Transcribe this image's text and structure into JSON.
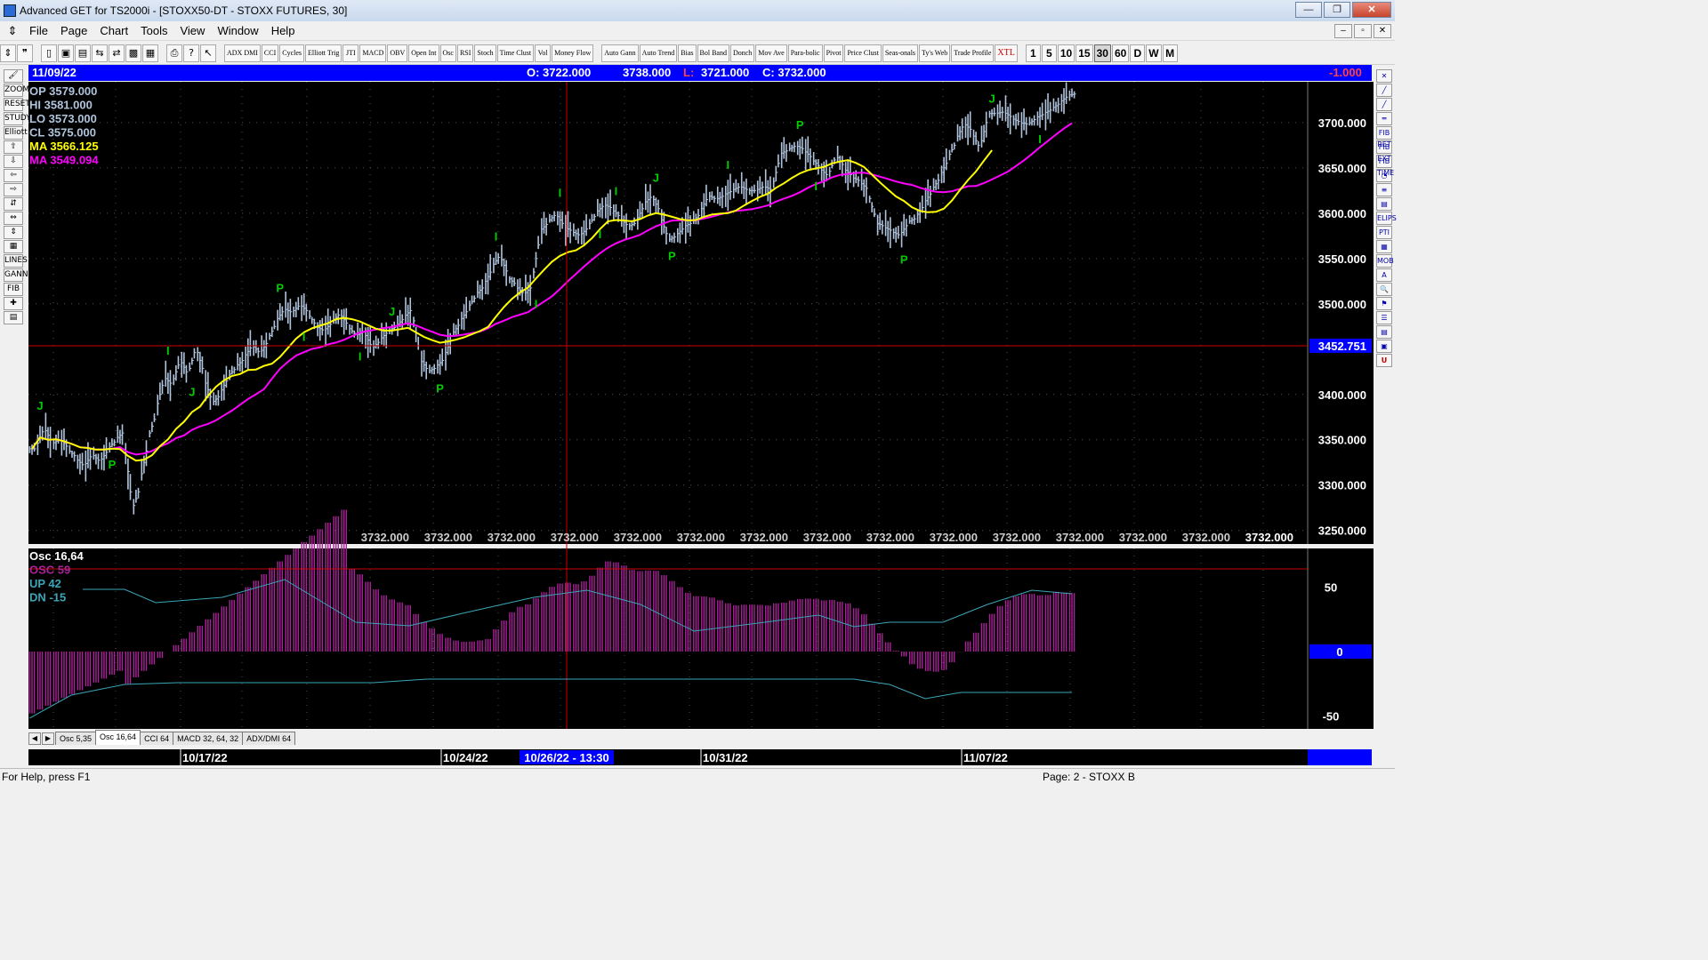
{
  "window": {
    "title": "Advanced GET for TS2000i - [STOXX50-DT - STOXX FUTURES, 30]",
    "buttons": {
      "minimize": "—",
      "maximize": "❐",
      "close": "✕"
    }
  },
  "menu": [
    "File",
    "Page",
    "Chart",
    "Tools",
    "View",
    "Window",
    "Help"
  ],
  "toolbar": {
    "studies": [
      "ADX DMI",
      "CCI",
      "Cycles",
      "Elliott Trig",
      "JTI",
      "MACD",
      "OBV",
      "Open Int",
      "Osc",
      "RSI",
      "Stoch",
      "Time Clust",
      "Vol",
      "Money Flow"
    ],
    "tools": [
      "Auto Gann",
      "Auto Trend",
      "Bias",
      "Bol Band",
      "Donch",
      "Mov Ave",
      "Para-bolic",
      "Pivot",
      "Price Clust",
      "Seas-onals",
      "Ty's Web",
      "Trade Profile",
      "XTL"
    ],
    "timeframes": [
      "1",
      "5",
      "10",
      "15",
      "30",
      "60",
      "D",
      "W",
      "M"
    ],
    "active_timeframe": "30"
  },
  "left_tools": [
    "🖌",
    "ZOOM",
    "RESET",
    "STUDY",
    "Elliott",
    "⇧",
    "⇩",
    "⇦",
    "⇨",
    "⇵",
    "⇔",
    "⇕",
    "▦",
    "LINES",
    "GANN",
    "FIB",
    "✚",
    "▤"
  ],
  "right_tools": [
    "✕",
    "╱",
    "╱",
    "═",
    "FIB RET",
    "FIB EXT",
    "FIB TIME",
    "◔",
    "≡",
    "▤",
    "ELIPS",
    "PTI",
    "▦",
    "MOB",
    "A",
    "🔍",
    "⚑",
    "☰",
    "▤",
    "▣",
    "U"
  ],
  "infobar": {
    "date": "11/09/22",
    "open": "O: 3722.000",
    "high": "3738.000",
    "low_label": "L:",
    "low": "3721.000",
    "close": "C: 3732.000",
    "change": "-1.000"
  },
  "legend": {
    "op": "OP  3579.000",
    "hi": "HI   3581.000",
    "lo": "LO  3573.000",
    "cl": "CL  3575.000",
    "ma1": "MA  3566.125",
    "ma2": "MA  3549.094"
  },
  "osc_legend": {
    "title": "Osc 16,64",
    "osc": "OSC 59",
    "up": "UP   42",
    "dn": "DN   -15"
  },
  "cursor_price": "3452.751",
  "bottom_values": [
    "3732.000",
    "3732.000",
    "3732.000",
    "3732.000",
    "3732.000",
    "3732.000",
    "3732.000",
    "3732.000",
    "3732.000",
    "3732.000",
    "3732.000",
    "3732.000",
    "3732.000",
    "3732.000",
    "3732.000"
  ],
  "date_labels": [
    "10/17/22",
    "10/24/22",
    "10/31/22",
    "11/07/22"
  ],
  "cursor_date": "10/26/22 - 13:30",
  "tabs": [
    "Osc 5,35",
    "Osc 16,64",
    "CCI 64",
    "MACD 32, 64, 32",
    "ADX/DMI 64"
  ],
  "active_tab": "Osc 16,64",
  "status": {
    "help": "For Help, press F1",
    "page": "Page: 2 - STOXX B"
  },
  "colors": {
    "chart_bg": "#000000",
    "bars": "#b0c4de",
    "ma_fast": "#ffff00",
    "ma_slow": "#ff00ff",
    "label": "#00cc00",
    "axis_text": "#ffffff",
    "infobar": "#0000ff",
    "cursor": "#cc0000",
    "osc": "#aa2299",
    "band": "#3aa6b8"
  },
  "chart_data": {
    "type": "ohlc-bar",
    "y_ticks": [
      3700,
      3650,
      3600,
      3550,
      3500,
      3400,
      3350,
      3300,
      3250
    ],
    "y_range": [
      3235,
      3745
    ],
    "osc_ticks": [
      50,
      0,
      -50
    ],
    "osc_range": [
      -60,
      80
    ],
    "closes": [
      3340,
      3365,
      3345,
      3352,
      3340,
      3330,
      3320,
      3335,
      3325,
      3340,
      3350,
      3360,
      3270,
      3300,
      3350,
      3380,
      3420,
      3410,
      3440,
      3420,
      3455,
      3420,
      3390,
      3400,
      3420,
      3430,
      3440,
      3455,
      3445,
      3460,
      3480,
      3495,
      3490,
      3500,
      3490,
      3475,
      3470,
      3480,
      3490,
      3475,
      3465,
      3470,
      3450,
      3460,
      3470,
      3475,
      3485,
      3495,
      3440,
      3425,
      3430,
      3440,
      3465,
      3480,
      3495,
      3510,
      3520,
      3540,
      3555,
      3530,
      3520,
      3510,
      3520,
      3580,
      3590,
      3600,
      3585,
      3580,
      3575,
      3585,
      3600,
      3610,
      3605,
      3595,
      3585,
      3590,
      3610,
      3620,
      3600,
      3570,
      3575,
      3585,
      3590,
      3600,
      3620,
      3615,
      3620,
      3625,
      3630,
      3625,
      3625,
      3630,
      3625,
      3665,
      3670,
      3675,
      3670,
      3660,
      3650,
      3640,
      3665,
      3650,
      3640,
      3635,
      3625,
      3590,
      3585,
      3580,
      3575,
      3590,
      3595,
      3610,
      3625,
      3640,
      3660,
      3680,
      3700,
      3690,
      3670,
      3710,
      3710,
      3712,
      3705,
      3700,
      3698,
      3705,
      3710,
      3715,
      3722,
      3730,
      3732
    ],
    "labels": [
      {
        "text": "J",
        "i": 1,
        "pos": "above"
      },
      {
        "text": "P",
        "i": 12,
        "pos": "below"
      },
      {
        "text": "I",
        "i": 20,
        "pos": "above"
      },
      {
        "text": "J",
        "i": 23,
        "pos": "below"
      },
      {
        "text": "P",
        "i": 36,
        "pos": "above"
      },
      {
        "text": "I",
        "i": 39,
        "pos": "below"
      },
      {
        "text": "I",
        "i": 47,
        "pos": "below"
      },
      {
        "text": "J",
        "i": 52,
        "pos": "above"
      },
      {
        "text": "P",
        "i": 59,
        "pos": "below"
      },
      {
        "text": "I",
        "i": 67,
        "pos": "above"
      },
      {
        "text": "I",
        "i": 73,
        "pos": "below"
      },
      {
        "text": "I",
        "i": 76,
        "pos": "above"
      },
      {
        "text": "I",
        "i": 82,
        "pos": "below"
      },
      {
        "text": "I",
        "i": 84,
        "pos": "above"
      },
      {
        "text": "J",
        "i": 90,
        "pos": "above"
      },
      {
        "text": "P",
        "i": 92,
        "pos": "below"
      },
      {
        "text": "I",
        "i": 100,
        "pos": "above"
      },
      {
        "text": "P",
        "i": 111,
        "pos": "above"
      },
      {
        "text": "I",
        "i": 113,
        "pos": "below"
      },
      {
        "text": "P",
        "i": 126,
        "pos": "below"
      },
      {
        "text": "J",
        "i": 138,
        "pos": "above"
      },
      {
        "text": "I",
        "i": 145,
        "pos": "below"
      }
    ]
  }
}
